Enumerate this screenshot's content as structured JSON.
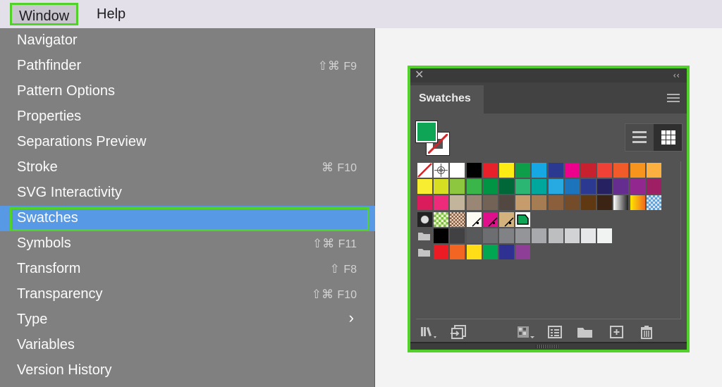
{
  "menubar": {
    "items": [
      {
        "label": "Window",
        "active": true
      },
      {
        "label": "Help",
        "active": false
      }
    ]
  },
  "window_menu": {
    "items": [
      {
        "label": "Navigator",
        "shortcut": null
      },
      {
        "label": "Pathfinder",
        "shortcut_mods": "⇧⌘",
        "shortcut_key": "F9"
      },
      {
        "label": "Pattern Options",
        "shortcut": null
      },
      {
        "label": "Properties",
        "shortcut": null
      },
      {
        "label": "Separations Preview",
        "shortcut": null
      },
      {
        "label": "Stroke",
        "shortcut_mods": "⌘",
        "shortcut_key": "F10"
      },
      {
        "label": "SVG Interactivity",
        "shortcut": null
      },
      {
        "label": "Swatches",
        "selected": true
      },
      {
        "label": "Symbols",
        "shortcut_mods": "⇧⌘",
        "shortcut_key": "F11"
      },
      {
        "label": "Transform",
        "shortcut_mods": "⇧",
        "shortcut_key": "F8"
      },
      {
        "label": "Transparency",
        "shortcut_mods": "⇧⌘",
        "shortcut_key": "F10"
      },
      {
        "label": "Type",
        "submenu": true,
        "submenu_glyph": "›"
      },
      {
        "label": "Variables",
        "shortcut": null
      },
      {
        "label": "Version History",
        "shortcut": null
      }
    ]
  },
  "swatches_panel": {
    "close_glyph": "✕",
    "collapse_glyph": "‹‹",
    "tab_label": "Swatches",
    "fill_color": "#0fa557",
    "stroke": "none",
    "view_mode": "grid",
    "rows": [
      [
        "none",
        "registration",
        "#ffffff",
        "#000000",
        "#e8202a",
        "#fdeb14",
        "#0e9d48",
        "#15a8e2",
        "#2b3990",
        "#ec008c",
        "#c7202f",
        "#ef4136",
        "#f15a29",
        "#f7941d",
        "#fbb040"
      ],
      [
        "#f9ed32",
        "#d7df23",
        "#8dc63f",
        "#39b54a",
        "#009444",
        "#006838",
        "#2bb673",
        "#00a79d",
        "#27aae1",
        "#1c75bc",
        "#2b3990",
        "#262262",
        "#662d91",
        "#92278f",
        "#9e1f63"
      ],
      [
        "#da1c5c",
        "#ee2a7b",
        "#c2b59b",
        "#998675",
        "#736357",
        "#534741",
        "#c69c6d",
        "#a67c52",
        "#8b5e3c",
        "#754c29",
        "#603913",
        "#3c2415",
        "gradient-silver",
        "gradient-yellow-orange",
        "pattern-blue"
      ],
      [
        "pattern-dots",
        "pattern-foliage",
        "pattern-paisley",
        "corner-white",
        "corner-magenta",
        "corner-tan",
        "shape-green"
      ]
    ],
    "groups": [
      {
        "icon": "folder-icon",
        "colors": [
          "#000000",
          "#414042",
          "#58595b",
          "#6d6e71",
          "#808285",
          "#939598",
          "#a7a9ac",
          "#bcbec0",
          "#d1d3d4",
          "#e6e7e8",
          "#f1f2f2"
        ]
      },
      {
        "icon": "folder-icon",
        "colors": [
          "#ed1c24",
          "#f26522",
          "#ffde17",
          "#00a651",
          "#2e3192",
          "#8e3e97"
        ]
      }
    ],
    "bottom_tools": [
      "swatch-libraries-menu",
      "place-swatches",
      "show-swatch-kinds-menu",
      "swatch-options",
      "new-color-group",
      "new-swatch",
      "delete-swatch"
    ]
  }
}
